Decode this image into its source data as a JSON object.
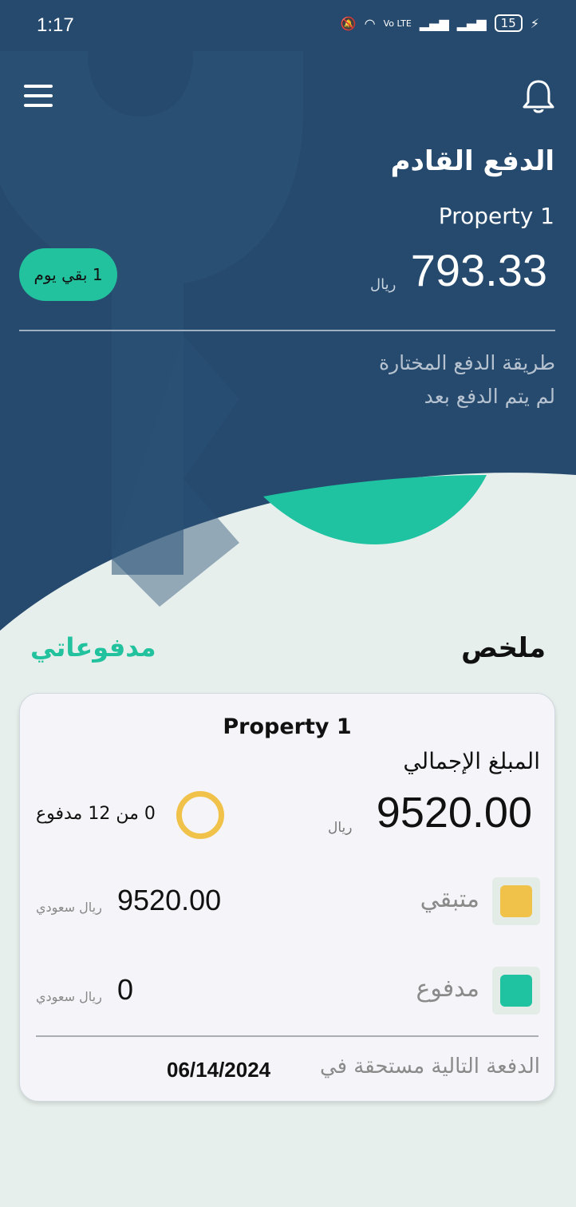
{
  "status_bar": {
    "time": "1:17",
    "network": "Vo LTE",
    "battery": "15"
  },
  "header": {
    "title": "الدفع القادم",
    "property": "Property 1",
    "amount": "793.33",
    "currency": "ريال",
    "days_left": "1 بقي يوم",
    "payment_method_label": "طريقة الدفع المختارة",
    "payment_method_value": "لم يتم الدفع بعد"
  },
  "section": {
    "summary": "ملخص",
    "my_payments": "مدفوعاتي"
  },
  "card": {
    "property": "Property 1",
    "total_label": "المبلغ الإجمالي",
    "total_amount": "9520.00",
    "total_currency": "ريال",
    "progress_text": "0 من 12 مدفوع",
    "progress_paid": 0,
    "progress_total": 12,
    "remaining_label": "متبقي",
    "remaining_amount": "9520.00",
    "remaining_currency": "ريال سعودي",
    "remaining_color": "#f0c24a",
    "paid_label": "مدفوع",
    "paid_amount": "0",
    "paid_currency": "ريال سعودي",
    "paid_color": "#1fc3a1",
    "next_due_label": "الدفعة التالية مستحقة في",
    "next_due_date": "06/14/2024"
  },
  "colors": {
    "header_bg": "#264a6e",
    "accent": "#21c29d",
    "page_bg": "#e6efeb"
  }
}
